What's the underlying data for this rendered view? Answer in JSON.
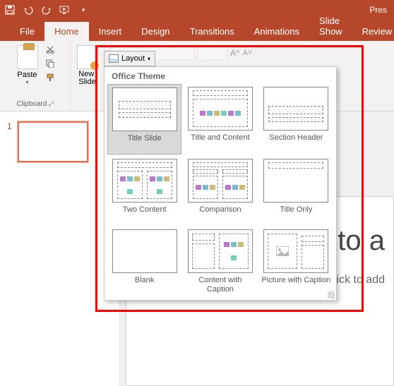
{
  "titlebar": {
    "title_partial": "Pres"
  },
  "tabs": [
    "File",
    "Home",
    "Insert",
    "Design",
    "Transitions",
    "Animations",
    "Slide Show",
    "Review"
  ],
  "active_tab": "Home",
  "ribbon": {
    "paste_label": "Paste",
    "clipboard_group": "Clipboard",
    "newslide_label_line1": "New",
    "newslide_label_line2": "Slide",
    "layout_button": "Layout"
  },
  "thumbnails": {
    "current_number": "1"
  },
  "slide": {
    "title_placeholder": "Click to a",
    "subtitle_placeholder": "Click to add "
  },
  "layout_dropdown": {
    "header": "Office Theme",
    "items": [
      {
        "label": "Title Slide",
        "kind": "title",
        "selected": true
      },
      {
        "label": "Title and Content",
        "kind": "title_content",
        "selected": false
      },
      {
        "label": "Section Header",
        "kind": "section_header",
        "selected": false
      },
      {
        "label": "Two Content",
        "kind": "two_content",
        "selected": false
      },
      {
        "label": "Comparison",
        "kind": "comparison",
        "selected": false
      },
      {
        "label": "Title Only",
        "kind": "title_only",
        "selected": false
      },
      {
        "label": "Blank",
        "kind": "blank",
        "selected": false
      },
      {
        "label": "Content with Caption",
        "kind": "content_caption",
        "selected": false
      },
      {
        "label": "Picture with Caption",
        "kind": "picture_caption",
        "selected": false
      }
    ]
  }
}
